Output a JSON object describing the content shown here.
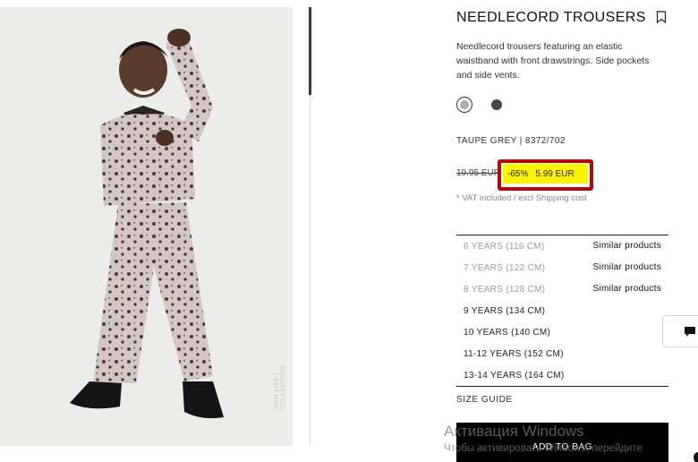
{
  "product": {
    "title": "NEEDLECORD TROUSERS",
    "description": "Needlecord trousers featuring an elastic waistband with front drawstrings. Side pockets and side vents.",
    "color_line": "TAUPE GREY | 8372/702",
    "photo_watermark": "JOIN LIFE | COLLECTION"
  },
  "colors": {
    "swatches": [
      {
        "name": "taupe-grey",
        "hex": "#b5aca4",
        "selected": true
      },
      {
        "name": "dark-grey",
        "hex": "#45454f",
        "selected": false
      }
    ],
    "sale_highlight": "#fff500",
    "highlight_border": "#b20a0a"
  },
  "price": {
    "old": "19.95 EUR",
    "discount": "-65%",
    "current": "5.99 EUR",
    "vat_note": "* VAT included / excl Shipping cost"
  },
  "sizes": [
    {
      "label": "6 YEARS (116 CM)",
      "available": false,
      "similar": "Similar products"
    },
    {
      "label": "7 YEARS (122 CM)",
      "available": false,
      "similar": "Similar products"
    },
    {
      "label": "8 YEARS (128 CM)",
      "available": false,
      "similar": "Similar products"
    },
    {
      "label": "9 YEARS (134 CM)",
      "available": true,
      "similar": ""
    },
    {
      "label": "10 YEARS (140 CM)",
      "available": true,
      "similar": ""
    },
    {
      "label": "11-12 YEARS (152 CM)",
      "available": true,
      "similar": ""
    },
    {
      "label": "13-14 YEARS (164 CM)",
      "available": true,
      "similar": ""
    }
  ],
  "actions": {
    "size_guide": "SIZE GUIDE",
    "add_to_bag": "ADD TO BAG"
  },
  "icons": {
    "bookmark": "bookmark-icon",
    "chat": "chat-icon"
  },
  "os_overlay": {
    "line1": "Активация Windows",
    "line2": "Чтобы активировать Windows, перейдите"
  }
}
